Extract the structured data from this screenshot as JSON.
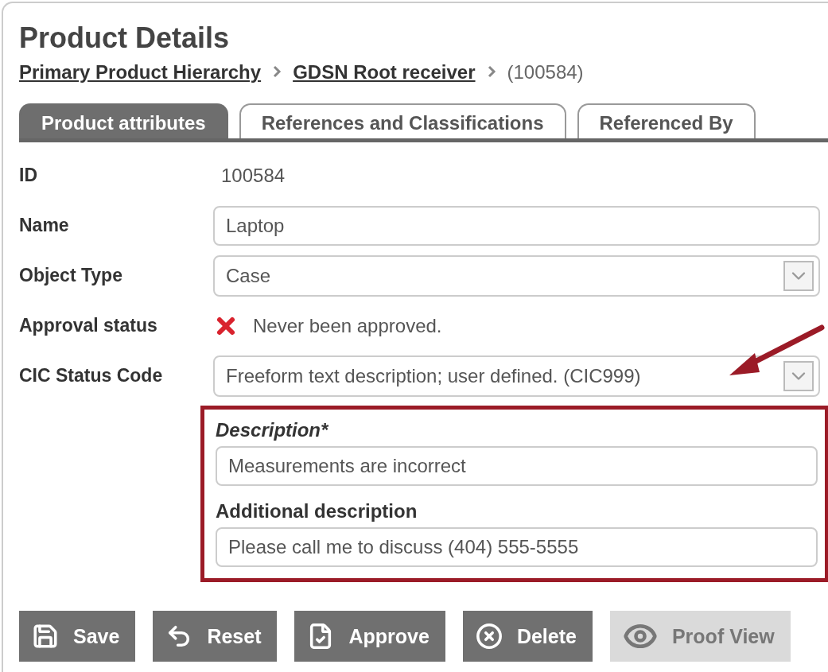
{
  "title": "Product Details",
  "breadcrumb": [
    {
      "label": "Primary Product Hierarchy",
      "kind": "link"
    },
    {
      "label": "GDSN Root receiver",
      "kind": "link"
    },
    {
      "label": "(100584)",
      "kind": "current"
    }
  ],
  "tabs": [
    {
      "label": "Product attributes",
      "selected": true
    },
    {
      "label": "References and Classifications",
      "selected": false
    },
    {
      "label": "Referenced By",
      "selected": false
    }
  ],
  "fields": [
    {
      "label": "ID",
      "kind": "text",
      "value": "100584"
    },
    {
      "label": "Name",
      "kind": "input",
      "value": "Laptop"
    },
    {
      "label": "Object Type",
      "kind": "select",
      "value": "Case"
    },
    {
      "label": "Approval status",
      "kind": "status",
      "approved": false,
      "value": "Never been approved."
    },
    {
      "label": "CIC Status Code",
      "kind": "select",
      "value": "Freeform text description; user defined. (CIC999)"
    }
  ],
  "highlighted_fields": [
    {
      "label": "Description*",
      "required": true,
      "value": "Measurements are incorrect"
    },
    {
      "label": "Additional description",
      "required": false,
      "value": "Please call me to discuss (404) 555-5555"
    }
  ],
  "buttons": [
    {
      "label": "Save",
      "kind": "save",
      "disabled": false
    },
    {
      "label": "Reset",
      "kind": "reset",
      "disabled": false
    },
    {
      "label": "Approve",
      "kind": "approve",
      "disabled": false
    },
    {
      "label": "Delete",
      "kind": "delete",
      "disabled": false
    },
    {
      "label": "Proof View",
      "kind": "proof",
      "disabled": true
    }
  ]
}
